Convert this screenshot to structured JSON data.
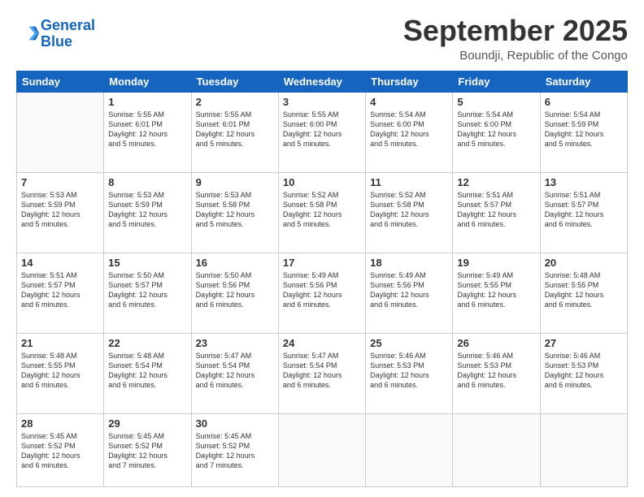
{
  "logo": {
    "text_general": "General",
    "text_blue": "Blue"
  },
  "header": {
    "title": "September 2025",
    "subtitle": "Boundji, Republic of the Congo"
  },
  "weekdays": [
    "Sunday",
    "Monday",
    "Tuesday",
    "Wednesday",
    "Thursday",
    "Friday",
    "Saturday"
  ],
  "weeks": [
    [
      {
        "day": "",
        "info": ""
      },
      {
        "day": "1",
        "info": "Sunrise: 5:55 AM\nSunset: 6:01 PM\nDaylight: 12 hours\nand 5 minutes."
      },
      {
        "day": "2",
        "info": "Sunrise: 5:55 AM\nSunset: 6:01 PM\nDaylight: 12 hours\nand 5 minutes."
      },
      {
        "day": "3",
        "info": "Sunrise: 5:55 AM\nSunset: 6:00 PM\nDaylight: 12 hours\nand 5 minutes."
      },
      {
        "day": "4",
        "info": "Sunrise: 5:54 AM\nSunset: 6:00 PM\nDaylight: 12 hours\nand 5 minutes."
      },
      {
        "day": "5",
        "info": "Sunrise: 5:54 AM\nSunset: 6:00 PM\nDaylight: 12 hours\nand 5 minutes."
      },
      {
        "day": "6",
        "info": "Sunrise: 5:54 AM\nSunset: 5:59 PM\nDaylight: 12 hours\nand 5 minutes."
      }
    ],
    [
      {
        "day": "7",
        "info": "Sunrise: 5:53 AM\nSunset: 5:59 PM\nDaylight: 12 hours\nand 5 minutes."
      },
      {
        "day": "8",
        "info": "Sunrise: 5:53 AM\nSunset: 5:59 PM\nDaylight: 12 hours\nand 5 minutes."
      },
      {
        "day": "9",
        "info": "Sunrise: 5:53 AM\nSunset: 5:58 PM\nDaylight: 12 hours\nand 5 minutes."
      },
      {
        "day": "10",
        "info": "Sunrise: 5:52 AM\nSunset: 5:58 PM\nDaylight: 12 hours\nand 5 minutes."
      },
      {
        "day": "11",
        "info": "Sunrise: 5:52 AM\nSunset: 5:58 PM\nDaylight: 12 hours\nand 6 minutes."
      },
      {
        "day": "12",
        "info": "Sunrise: 5:51 AM\nSunset: 5:57 PM\nDaylight: 12 hours\nand 6 minutes."
      },
      {
        "day": "13",
        "info": "Sunrise: 5:51 AM\nSunset: 5:57 PM\nDaylight: 12 hours\nand 6 minutes."
      }
    ],
    [
      {
        "day": "14",
        "info": "Sunrise: 5:51 AM\nSunset: 5:57 PM\nDaylight: 12 hours\nand 6 minutes."
      },
      {
        "day": "15",
        "info": "Sunrise: 5:50 AM\nSunset: 5:57 PM\nDaylight: 12 hours\nand 6 minutes."
      },
      {
        "day": "16",
        "info": "Sunrise: 5:50 AM\nSunset: 5:56 PM\nDaylight: 12 hours\nand 6 minutes."
      },
      {
        "day": "17",
        "info": "Sunrise: 5:49 AM\nSunset: 5:56 PM\nDaylight: 12 hours\nand 6 minutes."
      },
      {
        "day": "18",
        "info": "Sunrise: 5:49 AM\nSunset: 5:56 PM\nDaylight: 12 hours\nand 6 minutes."
      },
      {
        "day": "19",
        "info": "Sunrise: 5:49 AM\nSunset: 5:55 PM\nDaylight: 12 hours\nand 6 minutes."
      },
      {
        "day": "20",
        "info": "Sunrise: 5:48 AM\nSunset: 5:55 PM\nDaylight: 12 hours\nand 6 minutes."
      }
    ],
    [
      {
        "day": "21",
        "info": "Sunrise: 5:48 AM\nSunset: 5:55 PM\nDaylight: 12 hours\nand 6 minutes."
      },
      {
        "day": "22",
        "info": "Sunrise: 5:48 AM\nSunset: 5:54 PM\nDaylight: 12 hours\nand 6 minutes."
      },
      {
        "day": "23",
        "info": "Sunrise: 5:47 AM\nSunset: 5:54 PM\nDaylight: 12 hours\nand 6 minutes."
      },
      {
        "day": "24",
        "info": "Sunrise: 5:47 AM\nSunset: 5:54 PM\nDaylight: 12 hours\nand 6 minutes."
      },
      {
        "day": "25",
        "info": "Sunrise: 5:46 AM\nSunset: 5:53 PM\nDaylight: 12 hours\nand 6 minutes."
      },
      {
        "day": "26",
        "info": "Sunrise: 5:46 AM\nSunset: 5:53 PM\nDaylight: 12 hours\nand 6 minutes."
      },
      {
        "day": "27",
        "info": "Sunrise: 5:46 AM\nSunset: 5:53 PM\nDaylight: 12 hours\nand 6 minutes."
      }
    ],
    [
      {
        "day": "28",
        "info": "Sunrise: 5:45 AM\nSunset: 5:52 PM\nDaylight: 12 hours\nand 6 minutes."
      },
      {
        "day": "29",
        "info": "Sunrise: 5:45 AM\nSunset: 5:52 PM\nDaylight: 12 hours\nand 7 minutes."
      },
      {
        "day": "30",
        "info": "Sunrise: 5:45 AM\nSunset: 5:52 PM\nDaylight: 12 hours\nand 7 minutes."
      },
      {
        "day": "",
        "info": ""
      },
      {
        "day": "",
        "info": ""
      },
      {
        "day": "",
        "info": ""
      },
      {
        "day": "",
        "info": ""
      }
    ]
  ]
}
